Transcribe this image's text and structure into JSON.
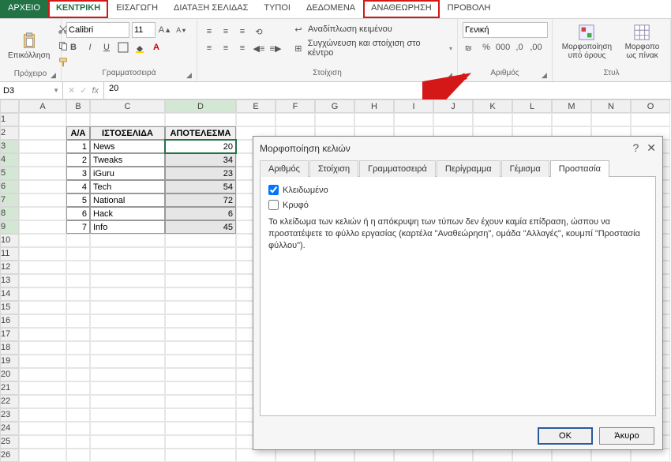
{
  "tabs": {
    "file": "ΑΡΧΕΙΟ",
    "home": "ΚΕΝΤΡΙΚΗ",
    "insert": "ΕΙΣΑΓΩΓΗ",
    "pagelayout": "ΔΙΑΤΑΞΗ ΣΕΛΙΔΑΣ",
    "types": "ΤΥΠΟΙ",
    "data": "ΔΕΔΟΜΕΝΑ",
    "review": "ΑΝΑΘΕΩΡΗΣΗ",
    "view": "ΠΡΟΒΟΛΗ"
  },
  "ribbon": {
    "clipboard": {
      "label": "Πρόχειρο",
      "paste": "Επικόλληση"
    },
    "font": {
      "label": "Γραμματοσειρά",
      "name": "Calibri",
      "size": "11",
      "bold": "B",
      "italic": "I",
      "underline": "U"
    },
    "align": {
      "label": "Στοίχιση",
      "wrap": "Αναδίπλωση κειμένου",
      "merge": "Συγχώνευση και στοίχιση στο κέντρο"
    },
    "number": {
      "label": "Αριθμός",
      "format": "Γενική"
    },
    "styles": {
      "label": "Στυλ",
      "cond": "Μορφοποίηση υπό όρους",
      "table": "Μορφοπο ως πίνακ"
    }
  },
  "fbar": {
    "name": "D3",
    "fx": "fx",
    "value": "20"
  },
  "cols": [
    "A",
    "B",
    "C",
    "D",
    "E",
    "F",
    "G",
    "H",
    "I",
    "J",
    "K",
    "L",
    "M",
    "N",
    "O"
  ],
  "rows": [
    "1",
    "2",
    "3",
    "4",
    "5",
    "6",
    "7",
    "8",
    "9",
    "10",
    "11",
    "12",
    "13",
    "14",
    "15",
    "16",
    "17",
    "18",
    "19",
    "20",
    "21",
    "22",
    "23",
    "24",
    "25",
    "26"
  ],
  "table": {
    "headers": {
      "aa": "A/A",
      "site": "ΙΣΤΟΣΕΛΙΔΑ",
      "result": "ΑΠΟΤΕΛΕΣΜΑ"
    },
    "rows": [
      {
        "aa": "1",
        "site": "News",
        "result": "20"
      },
      {
        "aa": "2",
        "site": "Tweaks",
        "result": "34"
      },
      {
        "aa": "3",
        "site": "iGuru",
        "result": "23"
      },
      {
        "aa": "4",
        "site": "Tech",
        "result": "54"
      },
      {
        "aa": "5",
        "site": "National",
        "result": "72"
      },
      {
        "aa": "6",
        "site": "Hack",
        "result": "6"
      },
      {
        "aa": "7",
        "site": "Info",
        "result": "45"
      }
    ]
  },
  "dialog": {
    "title": "Μορφοποίηση κελιών",
    "tabs": {
      "number": "Αριθμός",
      "align": "Στοίχιση",
      "font": "Γραμματοσειρά",
      "border": "Περίγραμμα",
      "fill": "Γέμισμα",
      "protect": "Προστασία"
    },
    "locked": "Κλειδωμένο",
    "hidden": "Κρυφό",
    "note": "Το κλείδωμα των κελιών ή η απόκρυψη των τύπων δεν έχουν καμία επίδραση, ώσπου να προστατέψετε το φύλλο εργασίας (καρτέλα \"Αναθεώρηση\", ομάδα \"Αλλαγές\", κουμπί \"Προστασία φύλλου\").",
    "ok": "OK",
    "cancel": "Άκυρο"
  }
}
